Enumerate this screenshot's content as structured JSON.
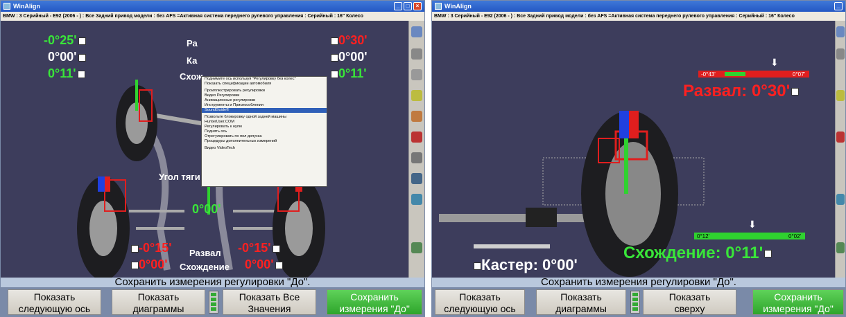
{
  "title": "WinAlign",
  "info": "BMW : 3 Серийный - E92 (2006 -   ) : Все Задний привод модели : без AFS =Активная система переднего рулевого управления : Серийный : 16\" Колесо",
  "status": "Сохранить измерения регулировки \"До\".",
  "left": {
    "values": {
      "camber_lf": "-0°25'",
      "caster_lf": "0°00'",
      "toe_lf": "0°11'",
      "camber_rf": "0°30'",
      "caster_rf": "0°00'",
      "toe_rf": "0°11'",
      "thrust": "0°00'",
      "camber_lr": "-0°15'",
      "toe_lr": "0°00'",
      "camber_rr": "-0°15'",
      "toe_rr": "0°00'"
    },
    "labels": {
      "camber_top": "Ра",
      "caster_top": "Ка",
      "toe_top": "Схож",
      "thrust": "Угол тяги",
      "camber_bottom": "Развал",
      "toe_bottom": "Схождение"
    },
    "menu": [
      "Поднимите ось используя \"Регулировку без колес\"",
      "Показать спецификации автомобиля",
      "",
      "Проиллюстрировать регулировки",
      "Видео Регулировки",
      "Анимационные регулировки",
      "Инструменты и Приспособления",
      "SoundGuide®",
      "",
      "Позвольте блокировку одной задней машины",
      "HunterUser.COM",
      "Регулировать к нулю",
      "Поднять ось",
      "Отрегулировать по пол допуска",
      "Процедуры дополнительных измерений",
      "",
      "Видео VideoTech"
    ],
    "buttons": [
      [
        "Показать",
        "следующую ось"
      ],
      [
        "Показать",
        "диаграммы"
      ],
      [
        "Показать Все",
        "Значения"
      ],
      [
        "Сохранить",
        "измерения \"До\""
      ]
    ]
  },
  "right": {
    "camber_range_low": "-0°43'",
    "camber_range_high": "0°07'",
    "camber": "Развал: 0°30'",
    "toe_range_low": "0°12'",
    "toe_range_high": "0°02'",
    "toe": "Схождение: 0°11'",
    "caster": "Кастер: 0°00'",
    "buttons": [
      [
        "Показать",
        "следующую ось"
      ],
      [
        "Показать",
        "диаграммы"
      ],
      [
        "Показать",
        "сверху"
      ],
      [
        "Сохранить",
        "измерения \"До\""
      ]
    ]
  }
}
